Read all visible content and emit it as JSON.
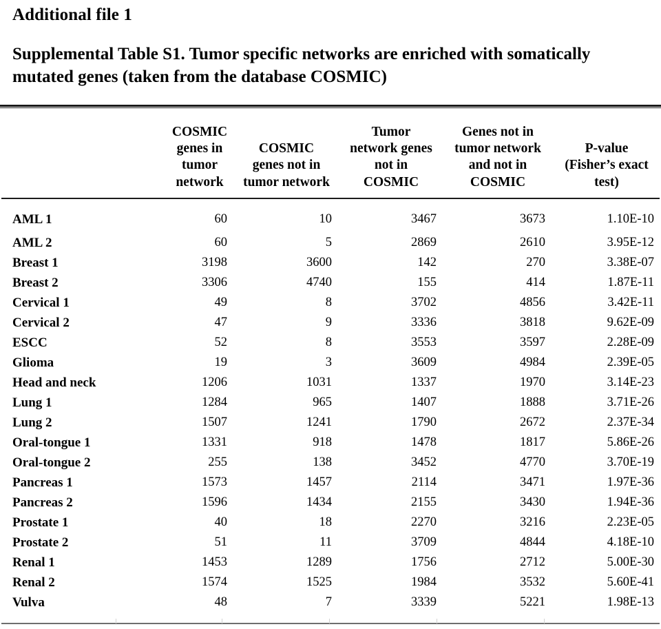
{
  "document": {
    "heading": "Additional file 1",
    "caption_label": "Supplemental Table S1.",
    "caption_text": "Tumor specific networks are enriched with somatically mutated genes (taken from the database COSMIC)"
  },
  "table": {
    "columns": [
      {
        "key": "label",
        "header": ""
      },
      {
        "key": "cosmic_in_network",
        "header_lines": [
          "COSMIC",
          "genes in tumor",
          "network"
        ]
      },
      {
        "key": "cosmic_not_in_network",
        "header_lines": [
          "COSMIC",
          "genes not in",
          "tumor network"
        ]
      },
      {
        "key": "network_not_cosmic",
        "header_lines": [
          "Tumor",
          "network genes",
          "not in",
          "COSMIC"
        ]
      },
      {
        "key": "not_network_not_cosmic",
        "header_lines": [
          "Genes not in",
          "tumor network",
          "and not in",
          "COSMIC"
        ]
      },
      {
        "key": "pvalue",
        "header_lines": [
          "P-value",
          "(Fisher’s exact",
          "test)"
        ]
      }
    ],
    "rows": [
      {
        "label": "AML 1",
        "c1": "60",
        "c2": "10",
        "c3": "3467",
        "c4": "3673",
        "p": "1.10E-10"
      },
      {
        "label": "AML 2",
        "c1": "60",
        "c2": "5",
        "c3": "2869",
        "c4": "2610",
        "p": "3.95E-12"
      },
      {
        "label": "Breast 1",
        "c1": "3198",
        "c2": "3600",
        "c3": "142",
        "c4": "270",
        "p": "3.38E-07"
      },
      {
        "label": "Breast 2",
        "c1": "3306",
        "c2": "4740",
        "c3": "155",
        "c4": "414",
        "p": "1.87E-11"
      },
      {
        "label": "Cervical 1",
        "c1": "49",
        "c2": "8",
        "c3": "3702",
        "c4": "4856",
        "p": "3.42E-11"
      },
      {
        "label": "Cervical 2",
        "c1": "47",
        "c2": "9",
        "c3": "3336",
        "c4": "3818",
        "p": "9.62E-09"
      },
      {
        "label": "ESCC",
        "c1": "52",
        "c2": "8",
        "c3": "3553",
        "c4": "3597",
        "p": "2.28E-09"
      },
      {
        "label": "Glioma",
        "c1": "19",
        "c2": "3",
        "c3": "3609",
        "c4": "4984",
        "p": "2.39E-05"
      },
      {
        "label": "Head and neck",
        "c1": "1206",
        "c2": "1031",
        "c3": "1337",
        "c4": "1970",
        "p": "3.14E-23"
      },
      {
        "label": "Lung 1",
        "c1": "1284",
        "c2": "965",
        "c3": "1407",
        "c4": "1888",
        "p": "3.71E-26"
      },
      {
        "label": "Lung 2",
        "c1": "1507",
        "c2": "1241",
        "c3": "1790",
        "c4": "2672",
        "p": "2.37E-34"
      },
      {
        "label": "Oral-tongue 1",
        "c1": "1331",
        "c2": "918",
        "c3": "1478",
        "c4": "1817",
        "p": "5.86E-26"
      },
      {
        "label": "Oral-tongue 2",
        "c1": "255",
        "c2": "138",
        "c3": "3452",
        "c4": "4770",
        "p": "3.70E-19"
      },
      {
        "label": "Pancreas 1",
        "c1": "1573",
        "c2": "1457",
        "c3": "2114",
        "c4": "3471",
        "p": "1.97E-36"
      },
      {
        "label": "Pancreas 2",
        "c1": "1596",
        "c2": "1434",
        "c3": "2155",
        "c4": "3430",
        "p": "1.94E-36"
      },
      {
        "label": "Prostate 1",
        "c1": "40",
        "c2": "18",
        "c3": "2270",
        "c4": "3216",
        "p": "2.23E-05"
      },
      {
        "label": "Prostate 2",
        "c1": "51",
        "c2": "11",
        "c3": "3709",
        "c4": "4844",
        "p": "4.18E-10"
      },
      {
        "label": "Renal 1",
        "c1": "1453",
        "c2": "1289",
        "c3": "1756",
        "c4": "2712",
        "p": "5.00E-30"
      },
      {
        "label": "Renal 2",
        "c1": "1574",
        "c2": "1525",
        "c3": "1984",
        "c4": "3532",
        "p": "5.60E-41"
      },
      {
        "label": "Vulva",
        "c1": "48",
        "c2": "7",
        "c3": "3339",
        "c4": "5221",
        "p": "1.98E-13"
      }
    ]
  },
  "colors": {
    "text": "#000000",
    "rule_dark": "#1a1a1a",
    "rule_light": "#6e6e6e",
    "background": "#ffffff"
  }
}
